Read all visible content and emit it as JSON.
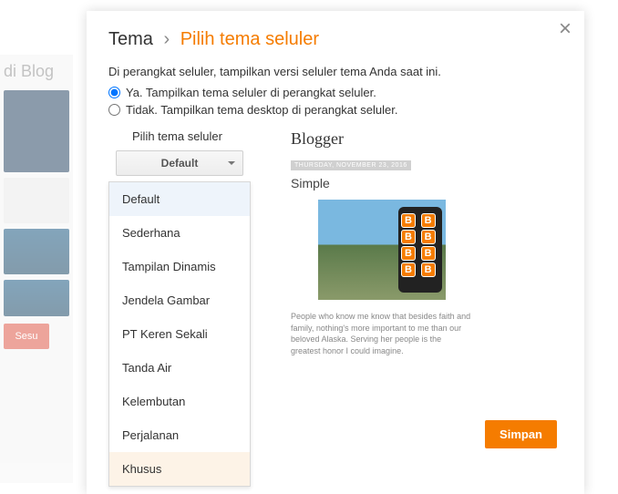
{
  "bg": {
    "title": "di Blog",
    "btn": "Sesu"
  },
  "breadcrumb": {
    "root": "Tema",
    "sep": "›",
    "current": "Pilih tema seluler"
  },
  "intro": "Di perangkat seluler, tampilkan versi seluler tema Anda saat ini.",
  "radio1": "Ya. Tampilkan tema seluler di perangkat seluler.",
  "radio2": "Tidak. Tampilkan tema desktop di perangkat seluler.",
  "dropdown": {
    "label": "Pilih tema seluler",
    "selected": "Default",
    "items": [
      "Default",
      "Sederhana",
      "Tampilan Dinamis",
      "Jendela Gambar",
      "PT Keren Sekali",
      "Tanda Air",
      "Kelembutan",
      "Perjalanan",
      "Khusus"
    ]
  },
  "preview": {
    "header": "Blogger",
    "date": "THURSDAY, NOVEMBER 23, 2016",
    "title": "Simple",
    "body": "People who know me know that besides faith and family, nothing's more important to me than our beloved Alaska. Serving her people is the greatest honor I could imagine."
  },
  "save": "Simpan",
  "close": "×"
}
